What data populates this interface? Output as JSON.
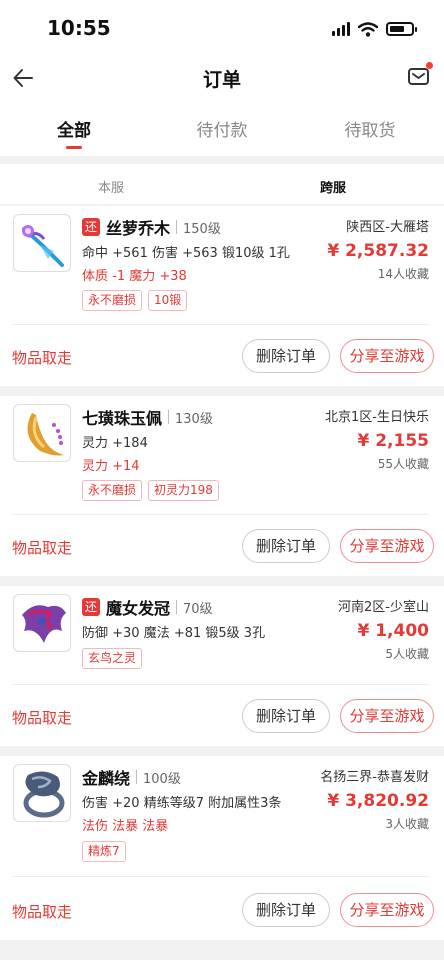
{
  "status_bar": {
    "time": "10:55"
  },
  "nav": {
    "title": "订单"
  },
  "tabs": [
    {
      "label": "全部"
    },
    {
      "label": "待付款"
    },
    {
      "label": "待取货"
    }
  ],
  "subtabs": [
    {
      "label": "本服"
    },
    {
      "label": "跨服"
    }
  ],
  "orders": [
    {
      "return_badge": "还",
      "name": "丝萝乔木",
      "level": "150级",
      "stats": "命中 +561 伤害 +563  锻10级  1孔",
      "red_stats": "体质 -1 魔力 +38",
      "tags": [
        "永不磨损",
        "10锻"
      ],
      "server": "陕西区-大雁塔",
      "price": "¥ 2,587.32",
      "favorites": "14人收藏",
      "status": "物品取走",
      "delete_label": "删除订单",
      "share_label": "分享至游戏"
    },
    {
      "name": "七璜珠玉佩",
      "level": "130级",
      "stats": "灵力 +184",
      "red_stats": "灵力 +14",
      "tags": [
        "永不磨损",
        "初灵力198"
      ],
      "server": "北京1区-生日快乐",
      "price": "¥ 2,155",
      "favorites": "55人收藏",
      "status": "物品取走",
      "delete_label": "删除订单",
      "share_label": "分享至游戏"
    },
    {
      "return_badge": "还",
      "name": "魔女发冠",
      "level": "70级",
      "stats": "防御 +30 魔法 +81  锻5级  3孔",
      "tags": [
        "玄鸟之灵"
      ],
      "server": "河南2区-少室山",
      "price": "¥ 1,400",
      "favorites": "5人收藏",
      "status": "物品取走",
      "delete_label": "删除订单",
      "share_label": "分享至游戏"
    },
    {
      "name": "金麟绕",
      "level": "100级",
      "stats": "伤害 +20  精练等级7  附加属性3条",
      "red_stats": "法伤 法暴 法暴",
      "tags": [
        "精炼7"
      ],
      "server": "名扬三界-恭喜发财",
      "price": "¥ 3,820.92",
      "favorites": "3人收藏",
      "status": "物品取走",
      "delete_label": "删除订单",
      "share_label": "分享至游戏"
    }
  ]
}
